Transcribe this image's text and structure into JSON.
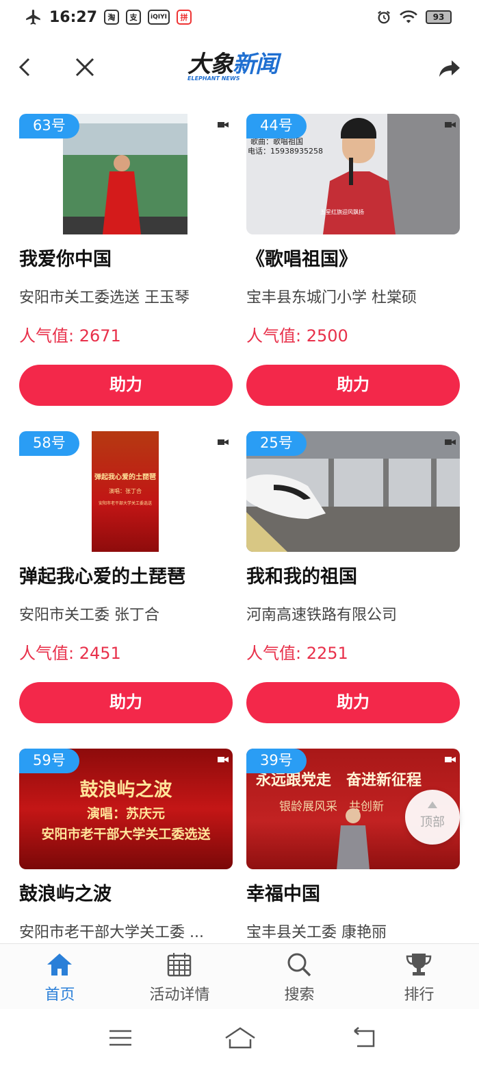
{
  "status": {
    "time": "16:27",
    "battery": "93",
    "app_icons": [
      "淘",
      "支",
      "iQIYI",
      "拼"
    ]
  },
  "header": {
    "logo_text_a": "大象",
    "logo_text_b": "新闻",
    "logo_sub": "ELEPHANT NEWS"
  },
  "cards": [
    {
      "number": "63号",
      "title": "我爱你中国",
      "author": "安阳市关工委选送 王玉琴",
      "popularity": "人气值: 2671",
      "button": "助力"
    },
    {
      "number": "44号",
      "title": "《歌唱祖国》",
      "author": "宝丰县东城门小学 杜棠硕",
      "popularity": "人气值: 2500",
      "button": "助力",
      "thumb_text": [
        "歌曲：歌唱祖国",
        "电话：15938935258",
        "五星红旗迎风飘扬"
      ]
    },
    {
      "number": "58号",
      "title": "弹起我心爱的土琵琶",
      "author": "安阳市关工委 张丁合",
      "popularity": "人气值: 2451",
      "button": "助力",
      "thumb_text": [
        "弹起我心爱的土琵琶",
        "演唱：张丁合",
        "安阳市老干部大学关工委选送"
      ]
    },
    {
      "number": "25号",
      "title": "我和我的祖国",
      "author": "河南高速铁路有限公司",
      "popularity": "人气值: 2251",
      "button": "助力"
    },
    {
      "number": "59号",
      "title": "鼓浪屿之波",
      "author": "安阳市老干部大学关工委 ...",
      "thumb_text": [
        "鼓浪屿之波",
        "演唱：苏庆元",
        "安阳市老干部大学关工委选送"
      ]
    },
    {
      "number": "39号",
      "title": "幸福中国",
      "author": "宝丰县关工委 康艳丽",
      "thumb_text": [
        "永远跟党走　奋进新征程",
        "银龄展风采　共创新"
      ]
    }
  ],
  "to_top": "顶部",
  "tabs": [
    {
      "label": "首页",
      "icon": "home-icon",
      "active": true
    },
    {
      "label": "活动详情",
      "icon": "calendar-icon"
    },
    {
      "label": "搜索",
      "icon": "search-icon"
    },
    {
      "label": "排行",
      "icon": "trophy-icon"
    }
  ],
  "colors": {
    "accent_blue": "#2a9df4",
    "button_red": "#f3284a",
    "popularity_red": "#e8304a",
    "tab_active": "#2a7fd8"
  }
}
